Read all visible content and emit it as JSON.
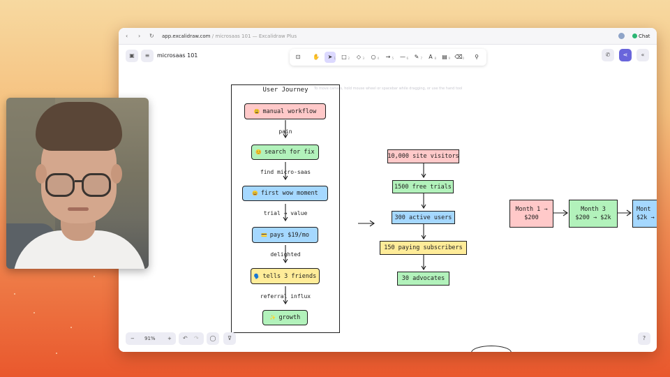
{
  "browser": {
    "url_domain": "app.excalidraw.com",
    "url_rest": " / microsaas 101 — Excalidraw Plus",
    "chat_label": "Chat"
  },
  "app": {
    "doc_title": "microsaas 101",
    "canvas_hint": "To move canvas, hold mouse wheel or spacebar while dragging, or use the hand tool",
    "tool_shortcuts": [
      "1",
      "2",
      "3",
      "4",
      "5",
      "6",
      "7",
      "8",
      "9",
      "0"
    ],
    "zoom_label": "91%",
    "zoom_minus": "−",
    "zoom_plus": "+"
  },
  "diagram": {
    "frame_title": "User Journey",
    "journey_nodes": [
      {
        "emoji": "😩",
        "label": "manual workflow",
        "color": "#ffc9c9"
      },
      {
        "emoji": "😊",
        "label": "search for fix",
        "color": "#b2f2bb"
      },
      {
        "emoji": "😀",
        "label": "first wow moment",
        "color": "#a5d8ff"
      },
      {
        "emoji": "💳",
        "label": "pays $19/mo",
        "color": "#a5d8ff"
      },
      {
        "emoji": "🗣️",
        "label": "tells 3 friends",
        "color": "#ffec99"
      },
      {
        "emoji": "✨",
        "label": "growth",
        "color": "#b2f2bb"
      }
    ],
    "journey_edges": [
      "pain",
      "find micro-saas",
      "trial → value",
      "delighted",
      "referral influx"
    ],
    "funnel_nodes": [
      {
        "label": "10,000 site visitors",
        "color": "#ffc9c9"
      },
      {
        "label": "1500 free trials",
        "color": "#b2f2bb"
      },
      {
        "label": "300 active users",
        "color": "#a5d8ff"
      },
      {
        "label": "150 paying subscribers",
        "color": "#ffec99"
      },
      {
        "label": "30 advocates",
        "color": "#b2f2bb"
      }
    ],
    "months": [
      {
        "line1": "Month 1 →",
        "line2": "$200",
        "color": "#ffc9c9"
      },
      {
        "line1": "Month 3",
        "line2": "$200 → $2k",
        "color": "#b2f2bb"
      },
      {
        "line1": "Mont",
        "line2": "$2k →",
        "color": "#a5d8ff"
      }
    ]
  }
}
